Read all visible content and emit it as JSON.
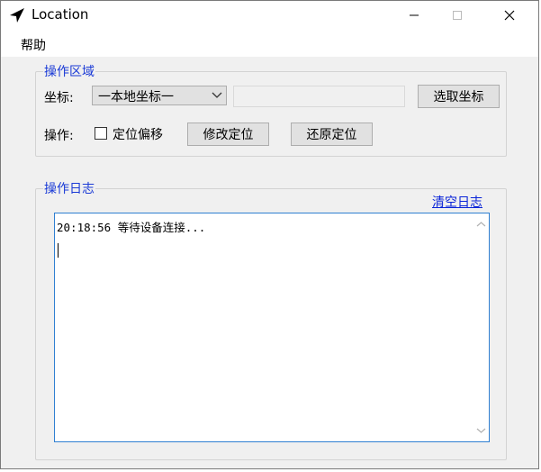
{
  "window": {
    "title": "Location"
  },
  "menu": {
    "help": "帮助"
  },
  "operation_area": {
    "legend": "操作区域",
    "coord_label": "坐标:",
    "coord_select_value": "一本地坐标一",
    "coord_input_value": "",
    "pick_coord_button": "选取坐标",
    "operation_label": "操作:",
    "offset_checkbox_label": "定位偏移",
    "offset_checked": false,
    "modify_location_button": "修改定位",
    "restore_location_button": "还原定位"
  },
  "log_area": {
    "legend": "操作日志",
    "clear_link": "清空日志",
    "lines": [
      "20:18:56 等待设备连接..."
    ]
  },
  "colors": {
    "legend_blue": "#1a3ad6",
    "link_blue": "#0a24d8",
    "log_border": "#2f7fd1"
  }
}
